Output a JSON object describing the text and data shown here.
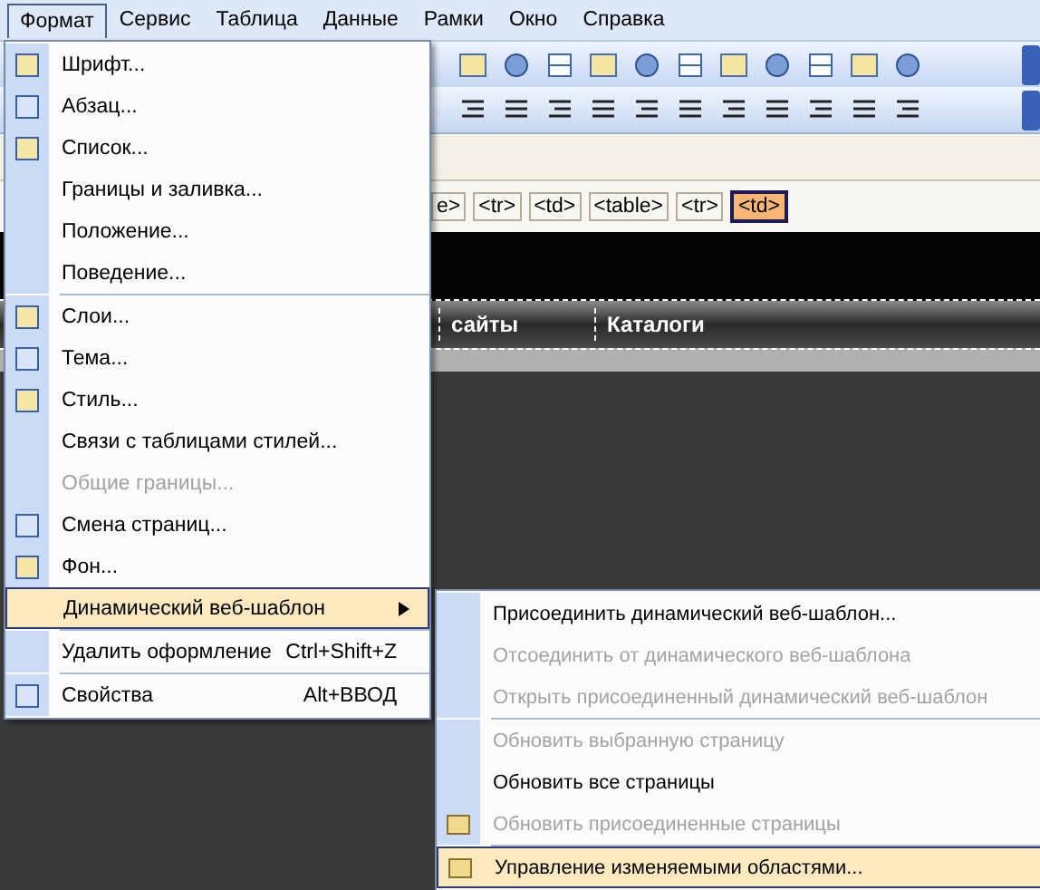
{
  "menubar": [
    {
      "label": "Формат",
      "selected": true
    },
    {
      "label": "Сервис",
      "selected": false
    },
    {
      "label": "Таблица",
      "selected": false
    },
    {
      "label": "Данные",
      "selected": false
    },
    {
      "label": "Рамки",
      "selected": false
    },
    {
      "label": "Окно",
      "selected": false
    },
    {
      "label": "Справка",
      "selected": false
    }
  ],
  "tag_bar": [
    {
      "label": "e>",
      "selected": false
    },
    {
      "label": "<tr>",
      "selected": false
    },
    {
      "label": "<td>",
      "selected": false
    },
    {
      "label": "<table>",
      "selected": false
    },
    {
      "label": "<tr>",
      "selected": false
    },
    {
      "label": "<td>",
      "selected": true
    }
  ],
  "page_nav": [
    "сайты",
    "Каталоги"
  ],
  "format_menu": [
    {
      "label": "Шрифт...",
      "disabled": false,
      "selected": false,
      "separator_before": false
    },
    {
      "label": "Абзац...",
      "disabled": false,
      "selected": false,
      "separator_before": false
    },
    {
      "label": "Список...",
      "disabled": false,
      "selected": false,
      "separator_before": false
    },
    {
      "label": "Границы и заливка...",
      "disabled": false,
      "selected": false,
      "separator_before": false
    },
    {
      "label": "Положение...",
      "disabled": false,
      "selected": false,
      "separator_before": false
    },
    {
      "label": "Поведение...",
      "disabled": false,
      "selected": false,
      "separator_before": false
    },
    {
      "label": "Слои...",
      "disabled": false,
      "selected": false,
      "separator_before": true
    },
    {
      "label": "Тема...",
      "disabled": false,
      "selected": false,
      "separator_before": false
    },
    {
      "label": "Стиль...",
      "disabled": false,
      "selected": false,
      "separator_before": false
    },
    {
      "label": "Связи с таблицами стилей...",
      "disabled": false,
      "selected": false,
      "separator_before": false
    },
    {
      "label": "Общие границы...",
      "disabled": true,
      "selected": false,
      "separator_before": false
    },
    {
      "label": "Смена страниц...",
      "disabled": false,
      "selected": false,
      "separator_before": false
    },
    {
      "label": "Фон...",
      "disabled": false,
      "selected": false,
      "separator_before": false
    },
    {
      "label": "Динамический веб-шаблон",
      "disabled": false,
      "selected": true,
      "separator_before": false,
      "submenu": true
    },
    {
      "label": "Удалить оформление",
      "shortcut": "Ctrl+Shift+Z",
      "disabled": false,
      "selected": false,
      "separator_before": true
    },
    {
      "label": "Свойства",
      "shortcut": "Alt+ВВОД",
      "disabled": false,
      "selected": false,
      "separator_before": true
    }
  ],
  "submenu": [
    {
      "label": "Присоединить динамический веб-шаблон...",
      "disabled": false,
      "selected": false,
      "separator_before": false
    },
    {
      "label": "Отсоединить от динамического веб-шаблона",
      "disabled": true,
      "selected": false,
      "separator_before": false
    },
    {
      "label": "Открыть присоединенный динамический веб-шаблон",
      "disabled": true,
      "selected": false,
      "separator_before": false
    },
    {
      "label": "Обновить выбранную страницу",
      "disabled": true,
      "selected": false,
      "separator_before": true
    },
    {
      "label": "Обновить все страницы",
      "disabled": false,
      "selected": false,
      "separator_before": false
    },
    {
      "label": "Обновить присоединенные страницы",
      "disabled": true,
      "selected": false,
      "separator_before": false
    },
    {
      "label": "Управление изменяемыми областями...",
      "disabled": false,
      "selected": true,
      "separator_before": true
    }
  ]
}
